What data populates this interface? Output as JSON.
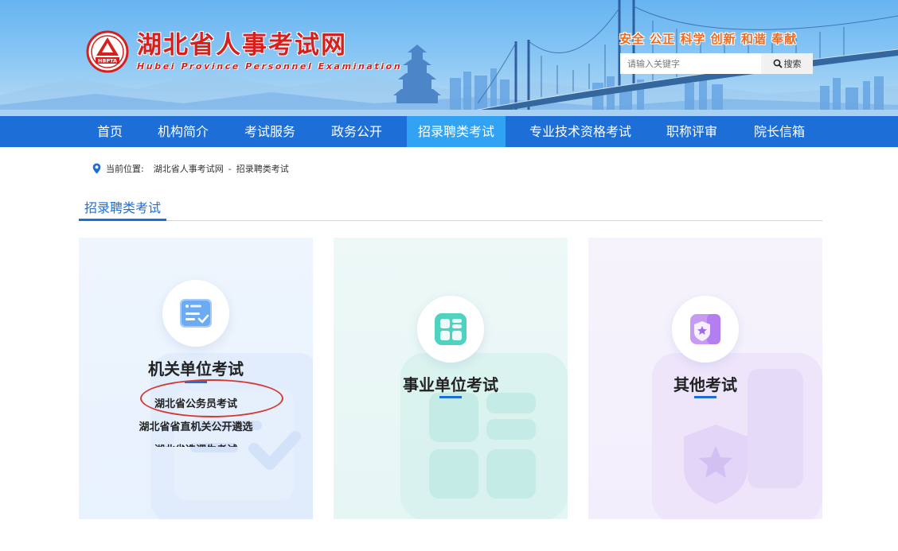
{
  "header": {
    "site_name_cn": "湖北省人事考试网",
    "site_name_en": "Hubei Province Personnel Examination",
    "emblem_text": "HBPTA",
    "slogan": "安全 公正 科学 创新 和谐 奉献",
    "search": {
      "placeholder": "请输入关键字",
      "button_label": "搜索",
      "button_icon": "search-icon"
    },
    "colors": {
      "logo_red": "#d7201e",
      "slogan_orange": "#ef6a1f"
    }
  },
  "nav": {
    "items": [
      {
        "label": "首页"
      },
      {
        "label": "机构简介"
      },
      {
        "label": "考试服务"
      },
      {
        "label": "政务公开"
      },
      {
        "label": "招录聘类考试",
        "active": true
      },
      {
        "label": "专业技术资格考试"
      },
      {
        "label": "职称评审"
      },
      {
        "label": "院长信箱"
      }
    ],
    "colors": {
      "bar": "#1d6fd7",
      "active": "#32a3f2"
    }
  },
  "breadcrumb": {
    "icon": "location-pin-icon",
    "prefix": "当前位置:",
    "items": [
      "湖北省人事考试网",
      "招录聘类考试"
    ],
    "separator": "-"
  },
  "section": {
    "title": "招录聘类考试"
  },
  "cards": [
    {
      "title": "机关单位考试",
      "icon": "document-check-icon",
      "items": [
        "湖北省公务员考试",
        "湖北省省直机关公开遴选",
        "湖北省选调生考试"
      ]
    },
    {
      "title": "事业单位考试",
      "icon": "grid-apps-icon",
      "items": []
    },
    {
      "title": "其他考试",
      "icon": "shield-star-icon",
      "items": []
    }
  ],
  "annotation": {
    "highlighted_item": "湖北省公务员考试",
    "color": "#d33a33"
  }
}
